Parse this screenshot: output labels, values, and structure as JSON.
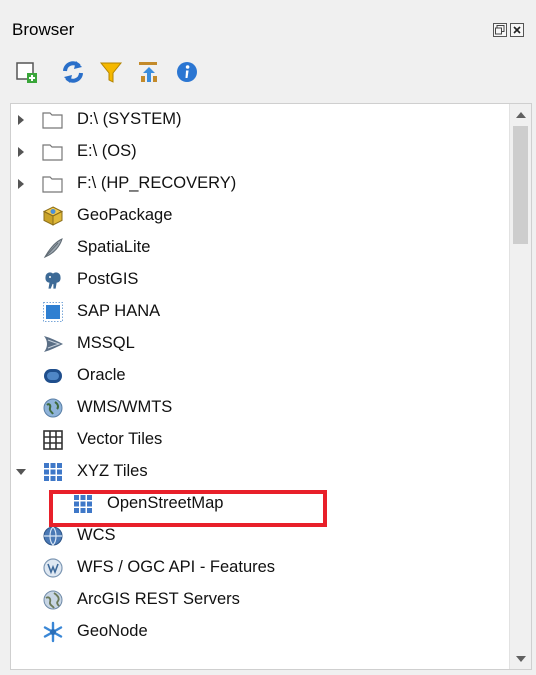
{
  "panel": {
    "title": "Browser"
  },
  "toolbar": {
    "buttons": [
      {
        "name": "add-layer-icon"
      },
      {
        "name": "refresh-icon"
      },
      {
        "name": "filter-icon"
      },
      {
        "name": "collapse-all-icon"
      },
      {
        "name": "info-icon"
      }
    ]
  },
  "tree": {
    "items": [
      {
        "label": "D:\\ (SYSTEM)",
        "icon": "folder-icon",
        "expander": "collapsed"
      },
      {
        "label": "E:\\ (OS)",
        "icon": "folder-icon",
        "expander": "collapsed"
      },
      {
        "label": "F:\\ (HP_RECOVERY)",
        "icon": "folder-icon",
        "expander": "collapsed"
      },
      {
        "label": "GeoPackage",
        "icon": "geopackage-icon"
      },
      {
        "label": "SpatiaLite",
        "icon": "spatialite-feather-icon"
      },
      {
        "label": "PostGIS",
        "icon": "postgis-elephant-icon"
      },
      {
        "label": "SAP HANA",
        "icon": "sap-hana-icon"
      },
      {
        "label": "MSSQL",
        "icon": "mssql-icon"
      },
      {
        "label": "Oracle",
        "icon": "oracle-icon"
      },
      {
        "label": "WMS/WMTS",
        "icon": "wms-globe-icon"
      },
      {
        "label": "Vector Tiles",
        "icon": "vector-tiles-grid-icon"
      },
      {
        "label": "XYZ Tiles",
        "icon": "xyz-tiles-icon",
        "expander": "expanded"
      },
      {
        "label": "OpenStreetMap",
        "icon": "xyz-tiles-icon",
        "child": true,
        "selected": true
      },
      {
        "label": "WCS",
        "icon": "wcs-globe-icon"
      },
      {
        "label": "WFS / OGC API - Features",
        "icon": "wfs-globe-icon"
      },
      {
        "label": "ArcGIS REST Servers",
        "icon": "arcgis-globe-icon"
      },
      {
        "label": "GeoNode",
        "icon": "geonode-icon"
      }
    ]
  },
  "colors": {
    "highlight": "#e8202a",
    "panel_bg": "#f0f0f0",
    "tree_bg": "#ffffff"
  }
}
